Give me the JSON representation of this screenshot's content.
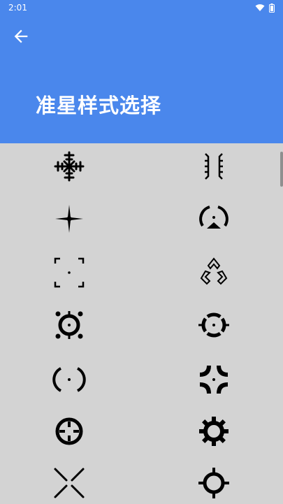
{
  "status": {
    "time": "2:01",
    "icons": [
      "wifi-icon",
      "battery-icon"
    ]
  },
  "header": {
    "title": "准星样式选择",
    "back_icon": "arrow-left-icon"
  },
  "colors": {
    "accent": "#4a87ec",
    "background": "#d3d3d3",
    "icon": "#000000"
  },
  "crosshairs": [
    {
      "name": "crosshair-snowflake",
      "icon": "snowflake-crosshair-icon"
    },
    {
      "name": "crosshair-bracket-lines",
      "icon": "bracket-lines-crosshair-icon"
    },
    {
      "name": "crosshair-propeller",
      "icon": "propeller-crosshair-icon"
    },
    {
      "name": "crosshair-arc-dot",
      "icon": "arc-dot-crosshair-icon"
    },
    {
      "name": "crosshair-corner-brackets",
      "icon": "corner-brackets-crosshair-icon"
    },
    {
      "name": "crosshair-triple-wing",
      "icon": "triple-wing-crosshair-icon"
    },
    {
      "name": "crosshair-circle-studs",
      "icon": "circle-studs-crosshair-icon"
    },
    {
      "name": "crosshair-split-ring",
      "icon": "split-ring-crosshair-icon"
    },
    {
      "name": "crosshair-parenthesis",
      "icon": "parenthesis-crosshair-icon"
    },
    {
      "name": "crosshair-curved-corners",
      "icon": "curved-corners-crosshair-icon"
    },
    {
      "name": "crosshair-ring-notches",
      "icon": "ring-notches-crosshair-icon"
    },
    {
      "name": "crosshair-gear",
      "icon": "gear-crosshair-icon"
    },
    {
      "name": "crosshair-cross-x",
      "icon": "cross-x-crosshair-icon"
    },
    {
      "name": "crosshair-ring-ticks",
      "icon": "ring-ticks-crosshair-icon"
    }
  ]
}
